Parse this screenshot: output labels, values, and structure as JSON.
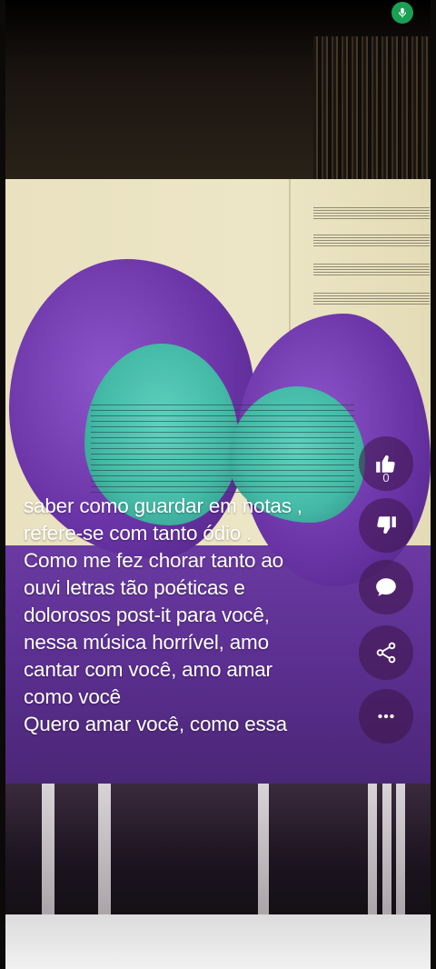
{
  "status": {
    "mic_icon": "mic-icon"
  },
  "lyrics": {
    "lines": [
      "saber como guardar em notas ,",
      "refere-se com tanto ódio  .",
      "Como me fez chorar tanto ao",
      "ouvi letras tão poéticas e",
      "dolorosos post-it para você,",
      "nessa música horrível,  amo",
      "cantar com você,  amo amar",
      "como você",
      "Quero amar você,  como essa"
    ]
  },
  "actions": {
    "like": {
      "icon": "thumbs-up-icon",
      "count": "0"
    },
    "dislike": {
      "icon": "thumbs-down-icon"
    },
    "comment": {
      "icon": "comment-icon"
    },
    "share": {
      "icon": "share-icon"
    },
    "more": {
      "icon": "more-icon"
    }
  },
  "colors": {
    "purple": "#6b35a8",
    "teal": "#4fc3af",
    "paper": "#ebe3c2",
    "mic_green": "#19a055"
  }
}
